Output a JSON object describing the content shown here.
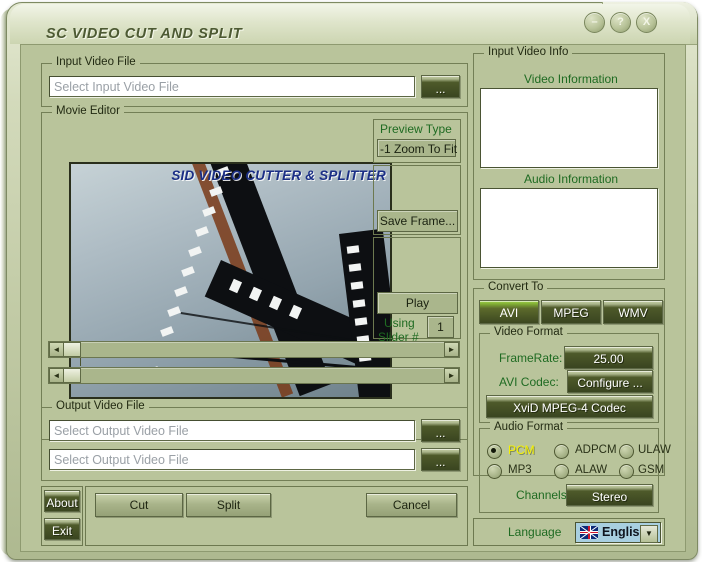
{
  "window": {
    "title": "SC VIDEO CUT AND SPLIT",
    "controls": {
      "minimize": "–",
      "help": "?",
      "close": "X"
    }
  },
  "input_video_file": {
    "group_title": "Input Video File",
    "field_placeholder": "Select Input Video File",
    "browse_label": "..."
  },
  "movie_editor": {
    "group_title": "Movie Editor",
    "preview_overlay_text": "SID VIDEO CUTTER & SPLITTER",
    "preview_type_label": "Preview Type",
    "preview_type_value": "-1 Zoom To Fit",
    "save_frame_label": "Save Frame...",
    "play_label": "Play",
    "using_slider_label_1": "Using",
    "using_slider_label_2": "Slider #",
    "slider_number": "1",
    "scrollbar_left": "◄",
    "scrollbar_right": "►"
  },
  "output_video_file": {
    "group_title": "Output Video File",
    "field1_placeholder": "Select Output Video File",
    "field2_placeholder": "Select Output Video File",
    "browse_label": "..."
  },
  "actions": {
    "about": "About",
    "exit": "Exit",
    "cut": "Cut",
    "split": "Split",
    "cancel": "Cancel"
  },
  "input_video_info": {
    "group_title": "Input Video Info",
    "video_information_label": "Video Information",
    "audio_information_label": "Audio Information",
    "video_information_value": "",
    "audio_information_value": ""
  },
  "convert_to": {
    "group_title": "Convert To",
    "tabs": [
      {
        "label": "AVI",
        "selected": true
      },
      {
        "label": "MPEG",
        "selected": false
      },
      {
        "label": "WMV",
        "selected": false
      }
    ]
  },
  "video_format": {
    "group_title": "Video Format",
    "framerate_label": "FrameRate:",
    "framerate_value": "25.00",
    "avi_codec_label": "AVI Codec:",
    "configure_label": "Configure ...",
    "codec_name": "XviD MPEG-4 Codec"
  },
  "audio_format": {
    "group_title": "Audio Format",
    "options": [
      {
        "label": "PCM",
        "selected": true
      },
      {
        "label": "ADPCM",
        "selected": false
      },
      {
        "label": "ULAW",
        "selected": false
      },
      {
        "label": "MP3",
        "selected": false
      },
      {
        "label": "ALAW",
        "selected": false
      },
      {
        "label": "GSM",
        "selected": false
      }
    ],
    "channels_label": "Channels:",
    "channels_value": "Stereo"
  },
  "language": {
    "label": "Language",
    "value": "English",
    "flag": "uk-flag-icon",
    "arrow": "▼"
  },
  "colors": {
    "skin_olive": "#b9c49b",
    "dark_button": "#3b4620",
    "selected_tab": "#84b336",
    "label_green": "#1f6b22",
    "label_yellow": "#f6f200",
    "preview_title_blue": "#1b2f86"
  }
}
